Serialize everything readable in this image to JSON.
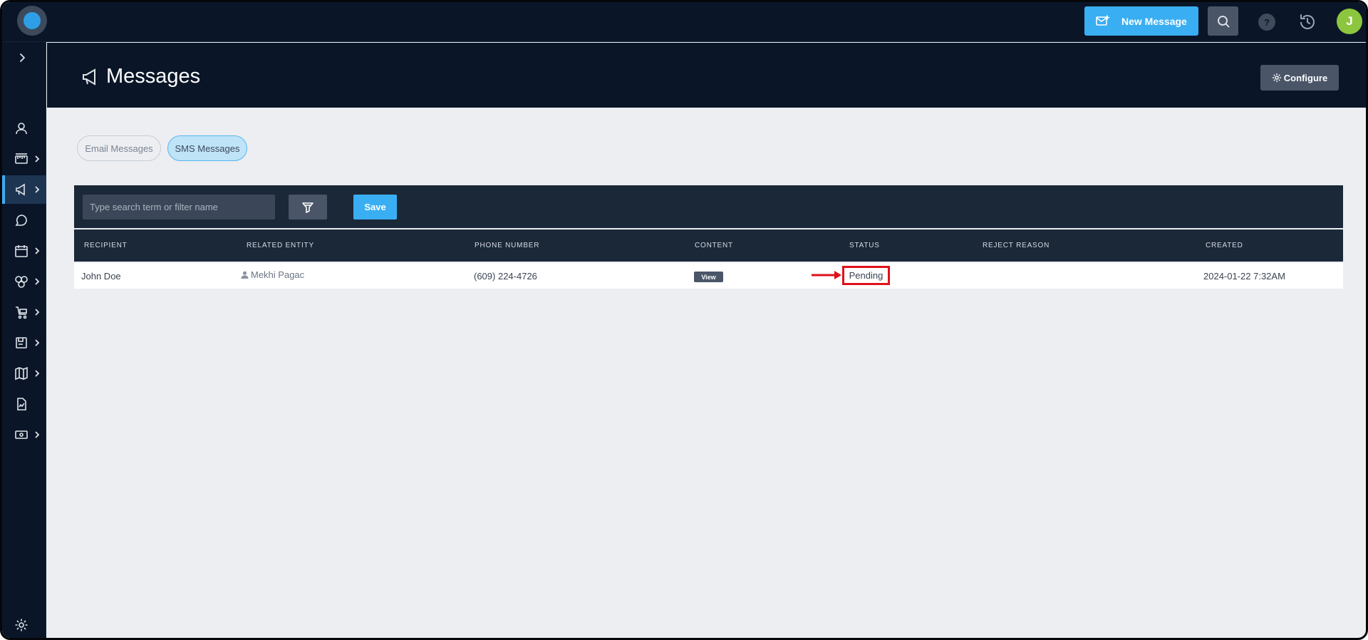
{
  "header": {
    "new_message_label": "New Message",
    "help_symbol": "?",
    "avatar_initial": "J"
  },
  "page": {
    "title": "Messages",
    "configure_label": "Configure"
  },
  "tabs": [
    {
      "label": "Email Messages",
      "active": false
    },
    {
      "label": "SMS Messages",
      "active": true
    }
  ],
  "toolbar": {
    "search_placeholder": "Type search term or filter name",
    "save_label": "Save"
  },
  "table": {
    "columns": [
      "RECIPIENT",
      "RELATED ENTITY",
      "PHONE NUMBER",
      "CONTENT",
      "STATUS",
      "REJECT REASON",
      "CREATED"
    ],
    "rows": [
      {
        "recipient": "John Doe",
        "related_entity": "Mekhi Pagac",
        "phone_number": "(609) 224-4726",
        "content_button": "View",
        "status": "Pending",
        "reject_reason": "",
        "created": "2024-01-22 7:32AM"
      }
    ]
  },
  "sidebar": {
    "icons": [
      "user-icon",
      "ruler-icon",
      "megaphone-icon",
      "chat-icon",
      "calendar-icon",
      "cluster-icon",
      "cart-icon",
      "save-icon",
      "map-icon",
      "report-icon",
      "cash-icon"
    ],
    "active": "megaphone-icon"
  },
  "colors": {
    "nav_bg": "#0a1628",
    "accent": "#3aaef2",
    "highlight": "#e0111a"
  }
}
